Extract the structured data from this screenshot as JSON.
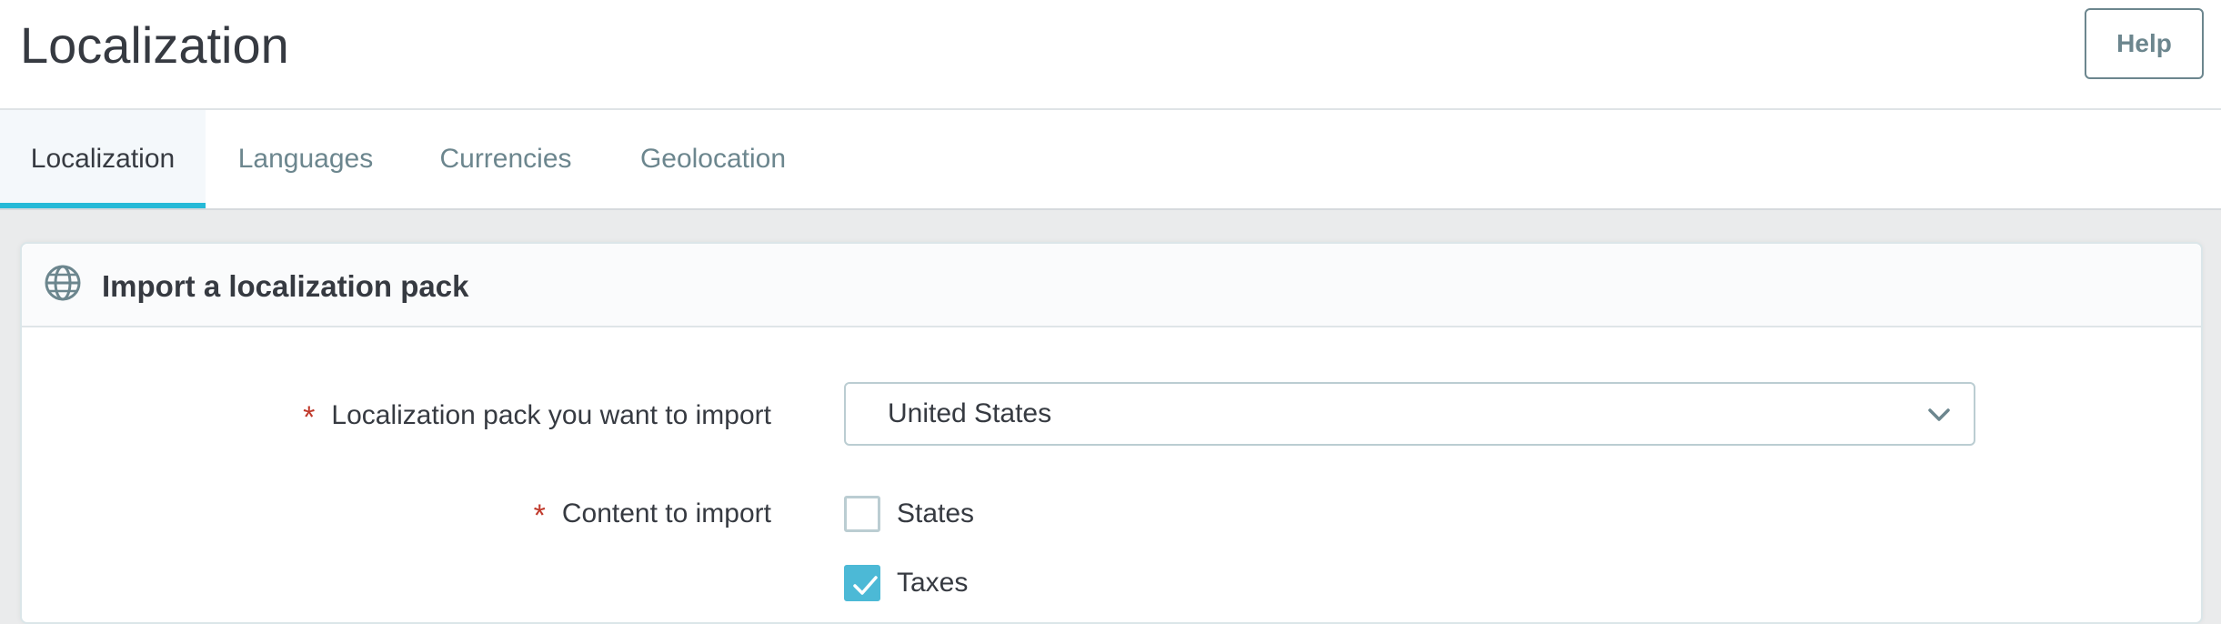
{
  "header": {
    "title": "Localization",
    "help_label": "Help"
  },
  "tabs": [
    {
      "label": "Localization",
      "active": true
    },
    {
      "label": "Languages",
      "active": false
    },
    {
      "label": "Currencies",
      "active": false
    },
    {
      "label": "Geolocation",
      "active": false
    }
  ],
  "panel": {
    "icon": "globe-icon",
    "title": "Import a localization pack",
    "fields": {
      "pack": {
        "required_mark": "*",
        "label": "Localization pack you want to import",
        "value": "United States"
      },
      "content": {
        "required_mark": "*",
        "label": "Content to import",
        "options": [
          {
            "label": "States",
            "checked": false
          },
          {
            "label": "Taxes",
            "checked": true
          }
        ]
      }
    }
  },
  "colors": {
    "accent": "#25b9d7",
    "checkbox_checked": "#4cb9d6",
    "required": "#c0392b",
    "text": "#363a41",
    "muted": "#6c868e"
  }
}
